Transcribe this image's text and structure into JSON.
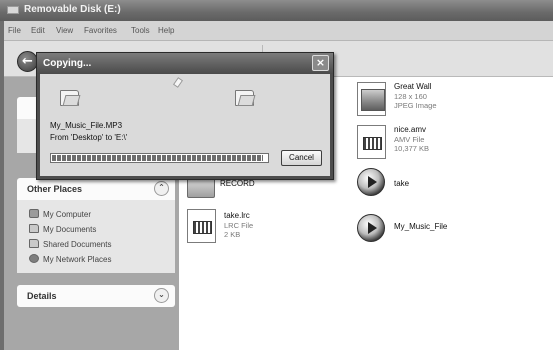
{
  "window": {
    "title": "Removable Disk (E:)"
  },
  "menu": [
    "File",
    "Edit",
    "View",
    "Favorites",
    "Tools",
    "Help"
  ],
  "other_places": {
    "title": "Other Places",
    "toggle_icon": "chevron-up-icon",
    "items": [
      {
        "label": "My Computer",
        "icon": "computer-icon"
      },
      {
        "label": "My Documents",
        "icon": "documents-folder-icon"
      },
      {
        "label": "Shared Documents",
        "icon": "shared-folder-icon"
      },
      {
        "label": "My Network Places",
        "icon": "network-icon"
      }
    ]
  },
  "details": {
    "title": "Details",
    "toggle_icon": "chevron-down-icon"
  },
  "files": {
    "great_wall": {
      "name": "Great Wall",
      "line1": "128 x 160",
      "line2": "JPEG Image"
    },
    "nice_amv": {
      "name": "nice.amv",
      "line1": "AMV File",
      "line2": "10,377 KB"
    },
    "record": {
      "name": "RECORD"
    },
    "take_media": {
      "name": "take"
    },
    "take_lrc": {
      "name": "take.lrc",
      "line1": "LRC File",
      "line2": "2 KB"
    },
    "my_music": {
      "name": "My_Music_File"
    }
  },
  "dialog": {
    "title": "Copying...",
    "file_name": "My_Music_File.MP3",
    "from_to": "From 'Desktop' to 'E:\\'",
    "progress_fraction": 0.98,
    "cancel_label": "Cancel",
    "close_label": "×"
  },
  "colors": {
    "window_frame": "#6e6e6e",
    "left_pane": "#a7a7a7",
    "dialog_frame": "#4d4d4d"
  }
}
